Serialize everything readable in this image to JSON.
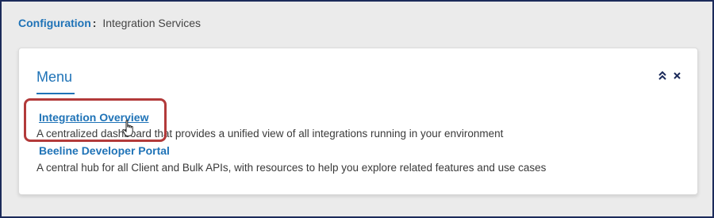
{
  "breadcrumb": {
    "parent": "Configuration",
    "separator": ":",
    "current": "Integration Services"
  },
  "menu_card": {
    "title": "Menu",
    "controls": {
      "collapse_icon": "double-chevron-up-icon",
      "close_icon": "close-icon"
    },
    "items": [
      {
        "label": "Integration Overview",
        "description": "A centralized dashboard that provides a unified view of all integrations running in your environment",
        "highlighted": true
      },
      {
        "label": "Beeline Developer Portal",
        "description": "A central hub for all Client and Bulk APIs, with resources to help you explore related features and use cases",
        "highlighted": false
      }
    ]
  },
  "colors": {
    "accent": "#1f73b7",
    "highlight_box": "#b23a3a",
    "background": "#ebebeb",
    "frame_border": "#1b2a5a"
  },
  "cursor": "hand-pointer-icon"
}
